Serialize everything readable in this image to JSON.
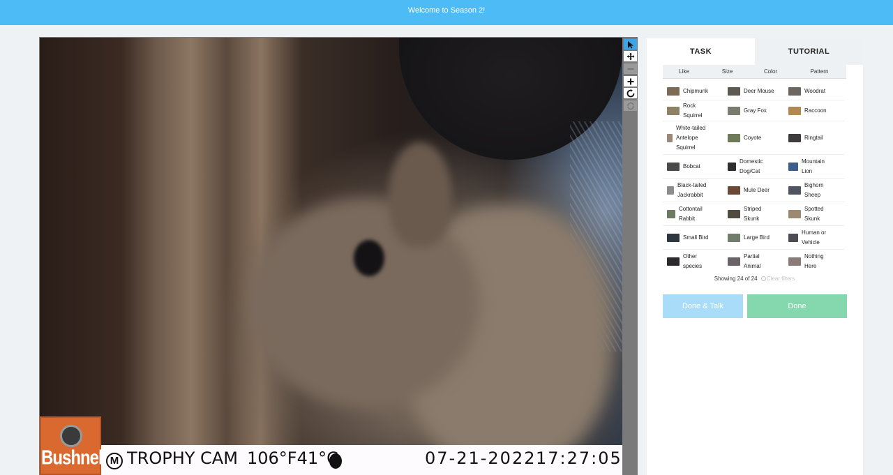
{
  "banner": {
    "text": "Welcome to Season 2!"
  },
  "viewer": {
    "camera_overlay": {
      "logo_text": "Bushnell",
      "brand_mark": "M",
      "model": "TROPHY CAM",
      "temperature": "106°F41°C",
      "date": "07-21-2022",
      "time": "17:27:05"
    },
    "tools": [
      {
        "name": "pointer-icon",
        "active": true
      },
      {
        "name": "move-icon",
        "active": false
      },
      {
        "name": "zoom-out-icon",
        "active": false
      },
      {
        "name": "zoom-in-icon",
        "active": false
      },
      {
        "name": "rotate-icon",
        "active": false
      },
      {
        "name": "reset-icon",
        "active": false
      }
    ]
  },
  "panel": {
    "tabs": [
      {
        "label": "TASK",
        "active": true
      },
      {
        "label": "TUTORIAL",
        "active": false
      }
    ],
    "filters": [
      "Like",
      "Size",
      "Color",
      "Pattern"
    ],
    "species": [
      {
        "label": "Chipmunk",
        "color": "#7d6a55"
      },
      {
        "label": "Deer Mouse",
        "color": "#5e5a52"
      },
      {
        "label": "Woodrat",
        "color": "#6b6660"
      },
      {
        "label": "Rock Squirrel",
        "color": "#8e8266"
      },
      {
        "label": "Gray Fox",
        "color": "#7a7c70"
      },
      {
        "label": "Raccoon",
        "color": "#b08850"
      },
      {
        "label": "White-tailed Antelope Squirrel",
        "color": "#9a8878"
      },
      {
        "label": "Coyote",
        "color": "#6f7a58"
      },
      {
        "label": "Ringtail",
        "color": "#3d3b3c"
      },
      {
        "label": "Bobcat",
        "color": "#4a4a48"
      },
      {
        "label": "Domestic Dog/Cat",
        "color": "#2f2d2e"
      },
      {
        "label": "Mountain Lion",
        "color": "#3b5f8a"
      },
      {
        "label": "Black-tailed Jackrabbit",
        "color": "#8c8c8c"
      },
      {
        "label": "Mule Deer",
        "color": "#6a4a35"
      },
      {
        "label": "Bighorn Sheep",
        "color": "#4f5560"
      },
      {
        "label": "Cottontail Rabbit",
        "color": "#6c7a62"
      },
      {
        "label": "Striped Skunk",
        "color": "#514a3e"
      },
      {
        "label": "Spotted Skunk",
        "color": "#9b8a70"
      },
      {
        "label": "Small Bird",
        "color": "#2e3640"
      },
      {
        "label": "Large Bird",
        "color": "#6f7d6a"
      },
      {
        "label": "Human or Vehicle",
        "color": "#4c4c54"
      },
      {
        "label": "Other species",
        "color": "#2c2a2c"
      },
      {
        "label": "Partial Animal",
        "color": "#6a6468"
      },
      {
        "label": "Nothing Here",
        "color": "#8a7a78"
      }
    ],
    "showing": {
      "text": "Showing 24 of 24",
      "clear_label": "Clear filters"
    },
    "buttons": {
      "done_talk": "Done & Talk",
      "done": "Done"
    }
  }
}
